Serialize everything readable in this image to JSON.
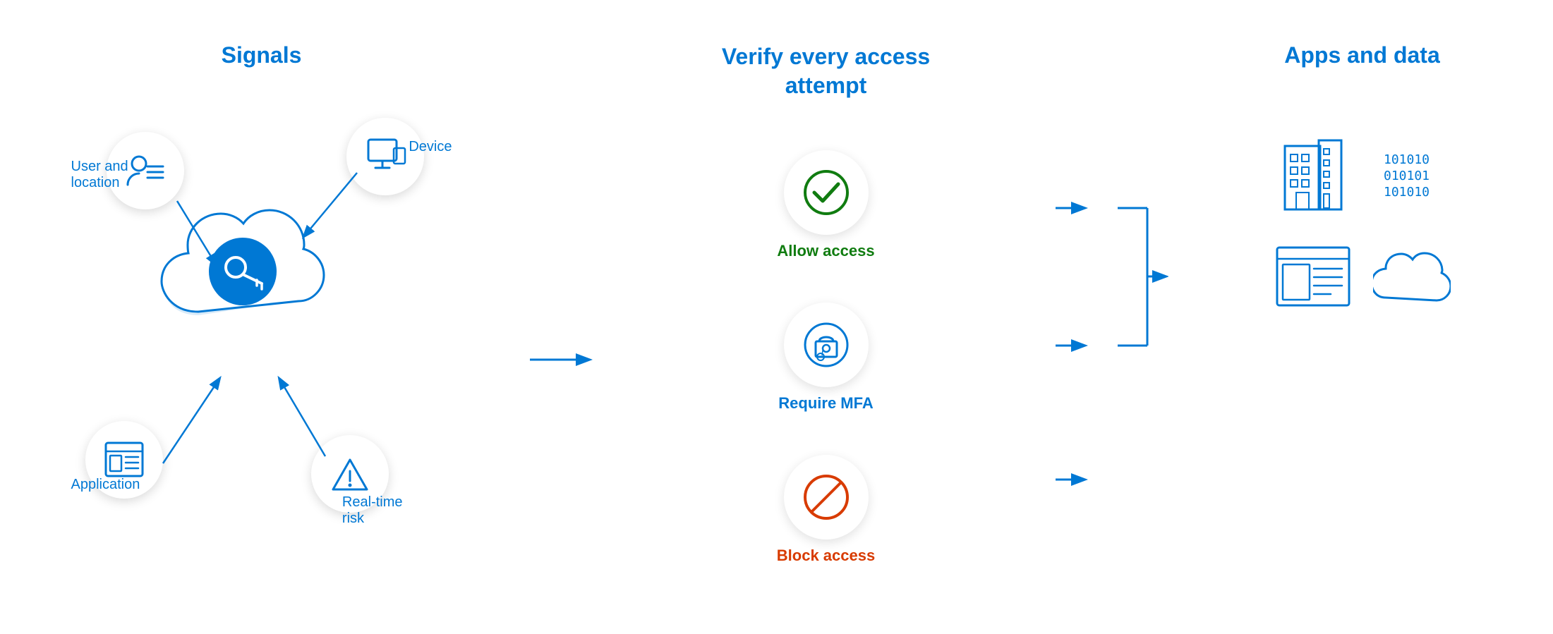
{
  "sections": {
    "signals": {
      "title": "Signals",
      "items": [
        {
          "id": "user-location",
          "label": "User and\nlocation",
          "icon": "user-list"
        },
        {
          "id": "device",
          "label": "Device",
          "icon": "monitor"
        },
        {
          "id": "application",
          "label": "Application",
          "icon": "app"
        },
        {
          "id": "realtime-risk",
          "label": "Real-time\nrisk",
          "icon": "warning"
        }
      ]
    },
    "verify": {
      "title": "Verify every access\nattempt",
      "items": [
        {
          "id": "allow",
          "label": "Allow access",
          "icon": "checkmark",
          "color": "green"
        },
        {
          "id": "mfa",
          "label": "Require MFA",
          "icon": "lock-person",
          "color": "blue"
        },
        {
          "id": "block",
          "label": "Block access",
          "icon": "block",
          "color": "red"
        }
      ]
    },
    "apps": {
      "title": "Apps and data",
      "items": [
        {
          "id": "building",
          "icon": "building"
        },
        {
          "id": "data-binary",
          "icon": "binary"
        },
        {
          "id": "dashboard",
          "icon": "dashboard"
        },
        {
          "id": "cloud",
          "icon": "cloud"
        }
      ]
    }
  },
  "colors": {
    "blue": "#0078d4",
    "green": "#107c10",
    "red": "#d83b01",
    "white": "#ffffff",
    "shadow": "rgba(0,0,0,0.15)"
  }
}
